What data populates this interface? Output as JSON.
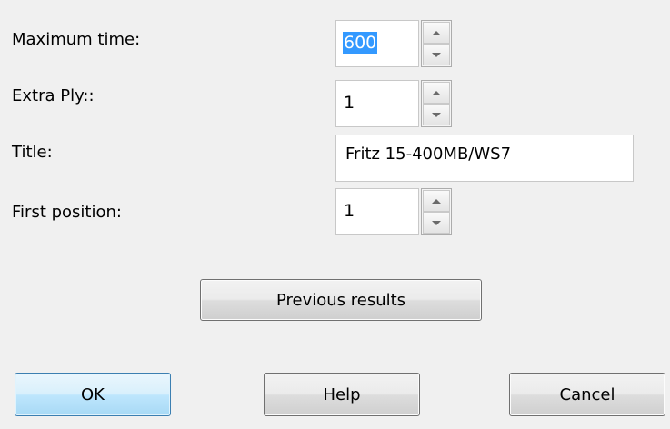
{
  "fields": {
    "max_time": {
      "label": "Maximum time:",
      "value": "600"
    },
    "extra_ply": {
      "label": "Extra Ply::",
      "value": "1"
    },
    "title": {
      "label": "Title:",
      "value": "Fritz 15-400MB/WS7"
    },
    "first_position": {
      "label": "First position:",
      "value": "1"
    }
  },
  "buttons": {
    "previous_results": "Previous results",
    "ok": "OK",
    "help": "Help",
    "cancel": "Cancel"
  },
  "colors": {
    "background": "#f0f0f0",
    "selection": "#3399ff",
    "default_button_border": "#3c7fb1"
  }
}
